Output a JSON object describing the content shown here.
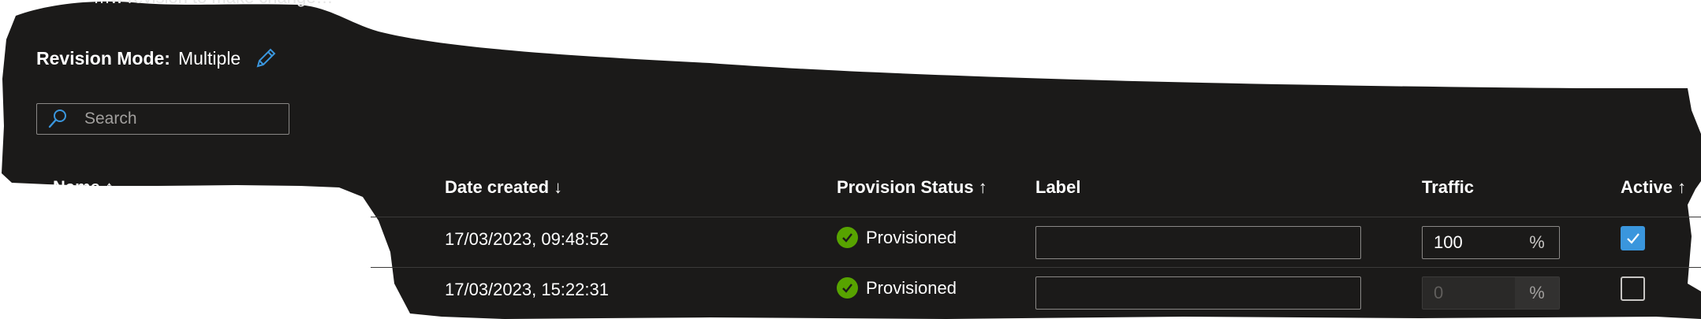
{
  "top_text": "…w revision to make change…",
  "revision_mode": {
    "label": "Revision Mode:",
    "value": "Multiple"
  },
  "search": {
    "placeholder": "Search",
    "value": ""
  },
  "columns": {
    "name": "Name ↑",
    "date_created": "Date created ↓",
    "provision_status": "Provision Status ↑",
    "label": "Label",
    "traffic": "Traffic",
    "active": "Active ↑"
  },
  "rows": [
    {
      "date": "17/03/2023, 09:48:52",
      "status": "Provisioned",
      "label": "",
      "traffic": "100",
      "traffic_unit": "%",
      "active": true
    },
    {
      "date": "17/03/2023, 15:22:31",
      "status": "Provisioned",
      "label": "",
      "traffic": "0",
      "traffic_unit": "%",
      "active": false
    }
  ],
  "colors": {
    "background": "#1b1a19",
    "accent": "#3a96dd",
    "success": "#57a300",
    "redaction": "#ffffff"
  },
  "icons": [
    "edit-icon",
    "search-icon",
    "check-circle-icon",
    "checkmark-icon"
  ]
}
